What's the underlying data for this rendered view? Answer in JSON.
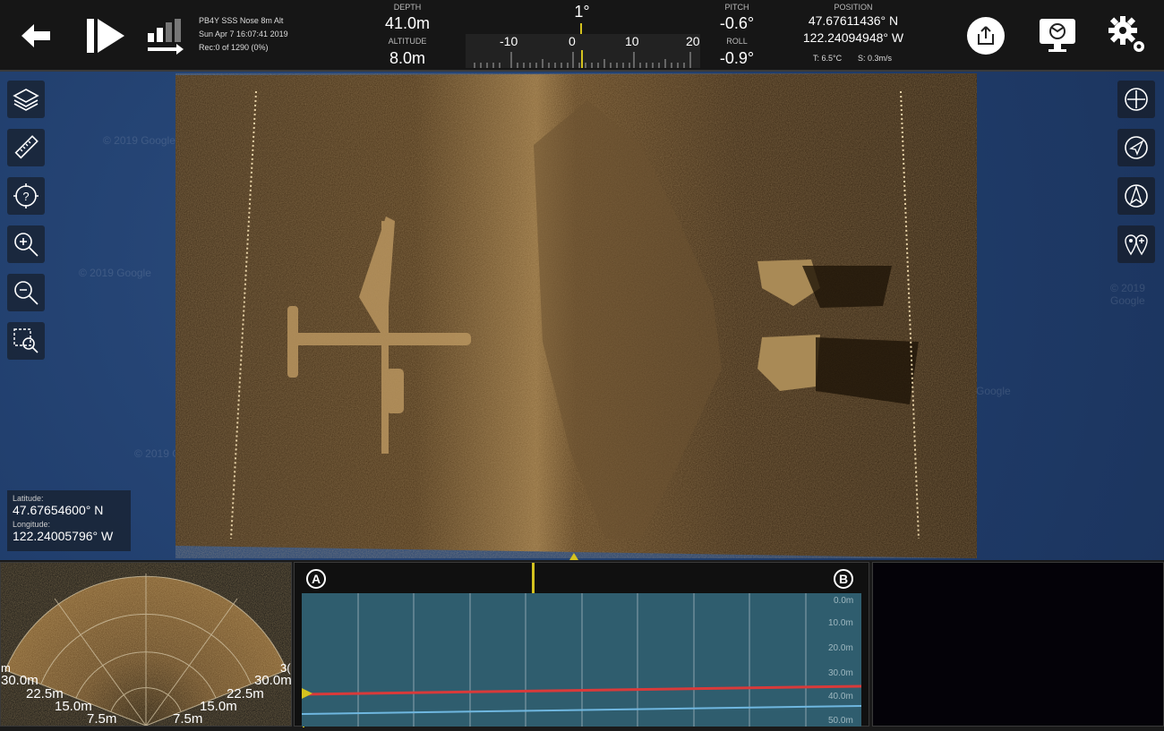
{
  "topbar": {
    "file_name": "PB4Y SSS Nose 8m Alt",
    "date": "Sun Apr 7 16:07:41 2019",
    "record": "Rec:0 of 1290 (0%)",
    "depth_label": "DEPTH",
    "depth_value": "41.0m",
    "altitude_label": "ALTITUDE",
    "altitude_value": "8.0m",
    "heading_value": "1°",
    "compass_ticks": [
      "-10",
      "0",
      "10",
      "20"
    ],
    "pitch_label": "PITCH",
    "pitch_value": "-0.6°",
    "roll_label": "ROLL",
    "roll_value": "-0.9°",
    "position_label": "POSITION",
    "position_lat": "47.67611436° N",
    "position_lon": "122.24094948° W",
    "temp": "T: 6.5°C",
    "speed": "S: 0.3m/s",
    "icons": [
      "back-arrow-icon",
      "play-step-icon",
      "signal-bars-icon",
      "share-icon",
      "screen-icon",
      "gear-icon"
    ]
  },
  "map": {
    "watermarks": [
      "© 2019 Google",
      "© 2019 Google",
      "© 2019 Google",
      "© 2019 G",
      "Google"
    ]
  },
  "cursor_coords": {
    "lat_label": "Latitude:",
    "lat_value": "47.67654600° N",
    "lon_label": "Longitude:",
    "lon_value": "122.24005796° W"
  },
  "left_tools": [
    "layers-icon",
    "ruler-icon",
    "help-target-icon",
    "zoom-in-icon",
    "zoom-out-icon",
    "zoom-region-icon"
  ],
  "right_tools": [
    "crosshair-icon",
    "navigate-icon",
    "north-arrow-icon",
    "marker-pins-icon"
  ],
  "fan": {
    "labels_left": [
      "m",
      "30.0m",
      "22.5m",
      "15.0m",
      "7.5m"
    ],
    "labels_right": [
      "3(",
      "30.0m",
      "22.5m",
      "15.0m",
      "7.5m"
    ]
  },
  "profile": {
    "marker_a": "A",
    "marker_b": "B",
    "depth_ticks": [
      "0.0m",
      "10.0m",
      "20.0m",
      "30.0m",
      "40.0m",
      "50.0m"
    ]
  },
  "colors": {
    "depth_line": "#d93a3a",
    "altitude_line": "#6fb7e0",
    "accent_green": "#2fb23a",
    "accent_yellow": "#d4c21f"
  }
}
